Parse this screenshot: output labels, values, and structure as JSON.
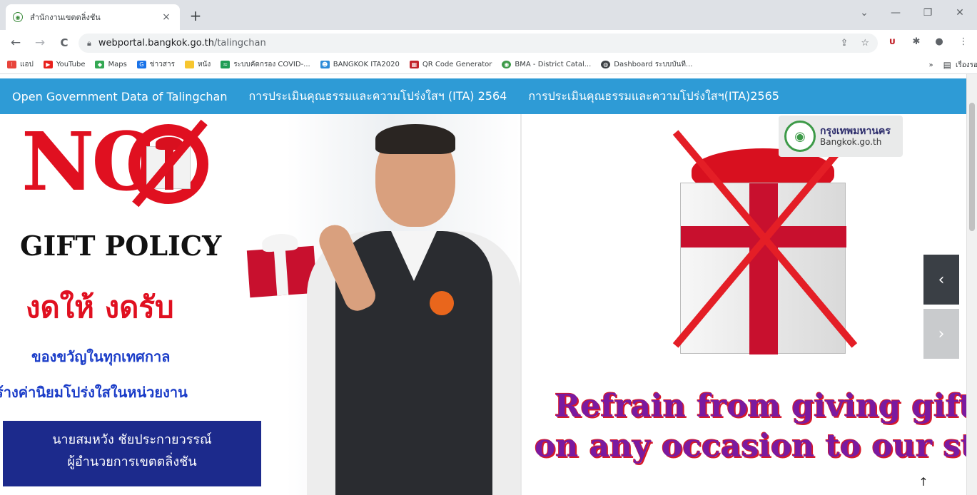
{
  "browser": {
    "tab": {
      "title": "สำนักงานเขตตลิ่งชัน",
      "close": "×"
    },
    "new_tab": "+",
    "window_controls": {
      "tabsearch": "⌄",
      "minimize": "—",
      "maximize": "❐",
      "close": "✕"
    },
    "nav": {
      "back": "←",
      "forward": "→",
      "reload": "C"
    },
    "url": {
      "host": "webportal.bangkok.go.th",
      "path": "/talingchan"
    },
    "bookmarks": [
      {
        "label": "แอป",
        "icon": "apps-grid-icon",
        "color": "#e8453c"
      },
      {
        "label": "YouTube",
        "icon": "youtube-icon",
        "color": "#e8201c"
      },
      {
        "label": "Maps",
        "icon": "maps-icon",
        "color": "#34a853"
      },
      {
        "label": "ข่าวสาร",
        "icon": "news-icon",
        "color": "#1a73e8"
      },
      {
        "label": "หนัง",
        "icon": "folder-icon",
        "color": "#f7c62f"
      },
      {
        "label": "ระบบคัดกรอง COVID-...",
        "icon": "wifi-icon",
        "color": "#1f9d55"
      },
      {
        "label": "BANGKOK ITA2020",
        "icon": "person-icon",
        "color": "#2d8bd8"
      },
      {
        "label": "QR Code Generator",
        "icon": "qr-icon",
        "color": "#c2232a"
      },
      {
        "label": "BMA - District Catal...",
        "icon": "bma-icon",
        "color": "#3d9a48"
      },
      {
        "label": "Dashboard ระบบบันที...",
        "icon": "globe-icon",
        "color": "#3c4043"
      }
    ],
    "bookmarks_more": "»",
    "reading_list": "เรื่องรออ่าน"
  },
  "site": {
    "nav": [
      "Open Government Data of Talingchan",
      "การประเมินคุณธรรมและความโปร่งใสฯ (ITA) 2564",
      "การประเมินคุณธรรมและความโปร่งใสฯ(ITA)2565"
    ]
  },
  "slide_left": {
    "no": "NO",
    "gift_policy": "GIFT POLICY",
    "headline_th": "งดให้ งดรับ",
    "line1_th": "ของขวัญในทุกเทศกาล",
    "line2_th": "ร้างค่านิยมโปร่งใสในหน่วยงาน",
    "name": "นายสมหวัง ชัยประกายวรรณ์",
    "position": "ผู้อำนวยการเขตตลิ่งชัน"
  },
  "slide_right": {
    "logo_th": "กรุงเทพมหานคร",
    "logo_en": "Bangkok.go.th",
    "line1": "Refrain from giving gift",
    "line2": "on any occasion to our st"
  },
  "controls": {
    "prev": "‹",
    "next": "›",
    "to_top": "↑"
  }
}
